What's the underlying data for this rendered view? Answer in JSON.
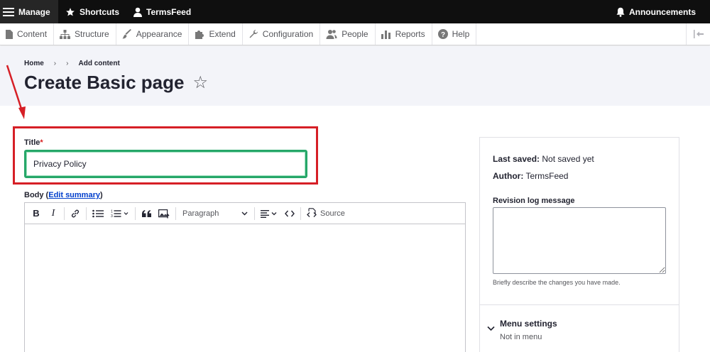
{
  "toolbar": {
    "manage": "Manage",
    "shortcuts": "Shortcuts",
    "user": "TermsFeed",
    "announcements": "Announcements"
  },
  "tray": {
    "items": [
      "Content",
      "Structure",
      "Appearance",
      "Extend",
      "Configuration",
      "People",
      "Reports",
      "Help"
    ]
  },
  "breadcrumb": {
    "home": "Home",
    "sep": "›",
    "current": "Add content"
  },
  "page": {
    "title": "Create Basic page",
    "star": "☆"
  },
  "form": {
    "title_label": "Title",
    "required_mark": "*",
    "title_value": "Privacy Policy",
    "body_label": "Body (",
    "edit_summary": "Edit summary",
    "body_label_end": ")"
  },
  "editor": {
    "bold": "B",
    "italic": "I",
    "paragraph": "Paragraph",
    "source": "Source"
  },
  "sidebar": {
    "last_saved_label": "Last saved:",
    "last_saved_value": "Not saved yet",
    "author_label": "Author:",
    "author_value": "TermsFeed",
    "revision_label": "Revision log message",
    "revision_help": "Briefly describe the changes you have made.",
    "menu_title": "Menu settings",
    "menu_sub": "Not in menu"
  },
  "colors": {
    "topbar": "#0f0f0f",
    "highlight": "#d61f26",
    "focus": "#26a769",
    "link": "#003ecc"
  }
}
